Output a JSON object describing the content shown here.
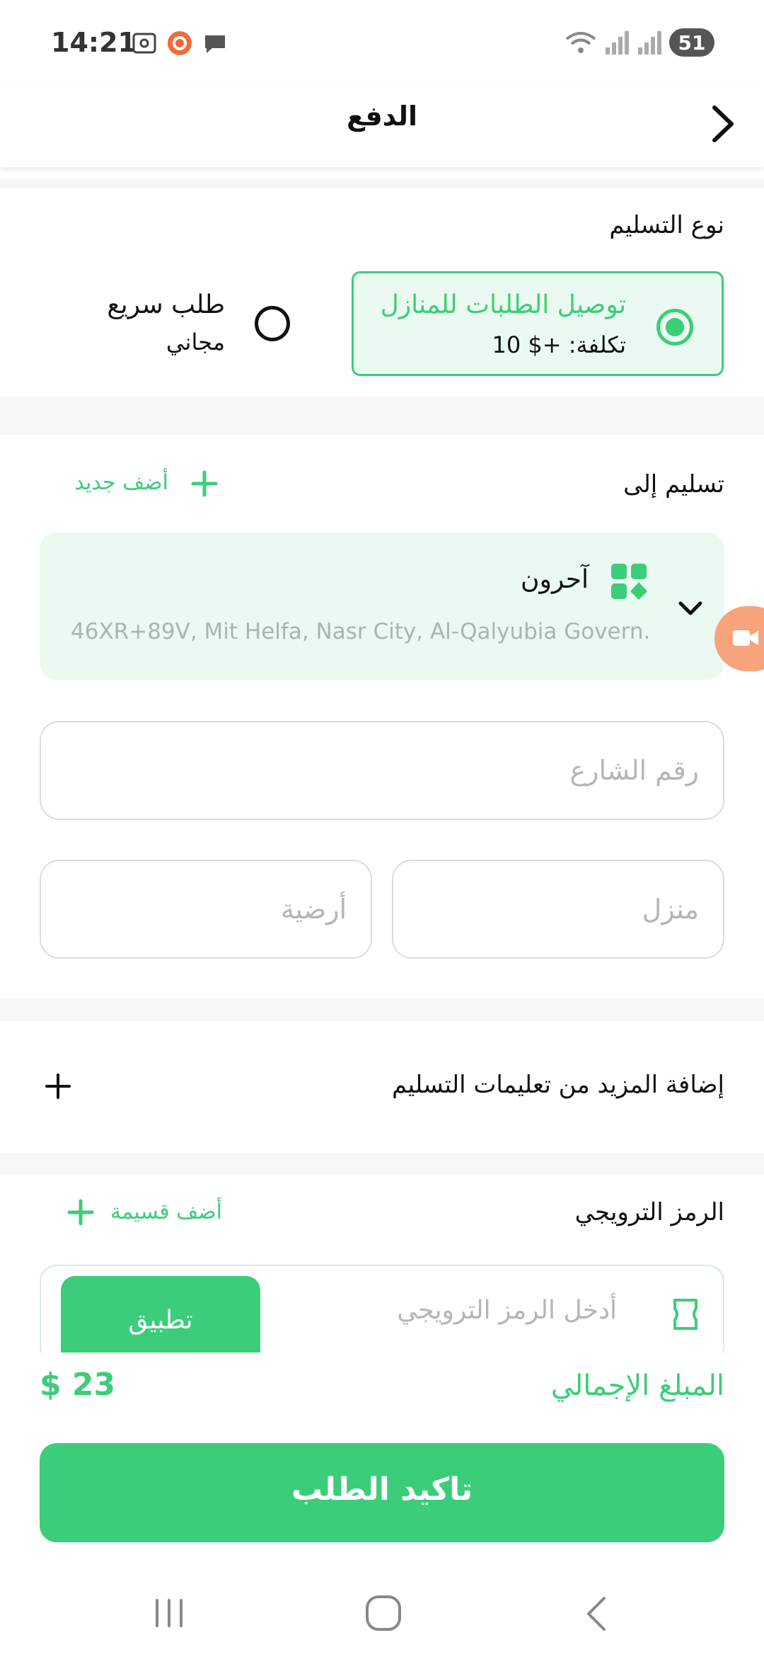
{
  "status_bar": {
    "time": "14:21",
    "battery": "51"
  },
  "header": {
    "title": "الدفع"
  },
  "delivery_type": {
    "label": "نوع التسليم",
    "home_delivery": {
      "title": "توصيل الطلبات للمنازل",
      "cost": "تكلفة: +$ 10",
      "selected": true
    },
    "quick_order": {
      "title": "طلب سريع",
      "cost": "مجاني",
      "selected": false
    }
  },
  "deliver_to": {
    "label": "تسليم إلى",
    "add_new": "أضف جديد",
    "address_title": "آحرون",
    "address_text": "46XR+89V, Mit Helfa, Nasr City, Al-Qalyubia Govern..."
  },
  "fields": {
    "street_placeholder": "رقم الشارع",
    "house_placeholder": "منزل",
    "floor_placeholder": "أرضية"
  },
  "instructions": {
    "label": "إضافة المزيد من تعليمات التسليم"
  },
  "promo": {
    "label": "الرمز الترويجي",
    "add_voucher": "أضف قسيمة",
    "placeholder": "أدخل الرمز الترويجي",
    "apply": "تطبيق"
  },
  "total": {
    "label": "المبلغ الإجمالي",
    "amount": "$ 23"
  },
  "confirm": {
    "label": "تاكيد الطلب"
  },
  "colors": {
    "accent": "#3ccd7a",
    "accent_light": "#eafaf1"
  }
}
